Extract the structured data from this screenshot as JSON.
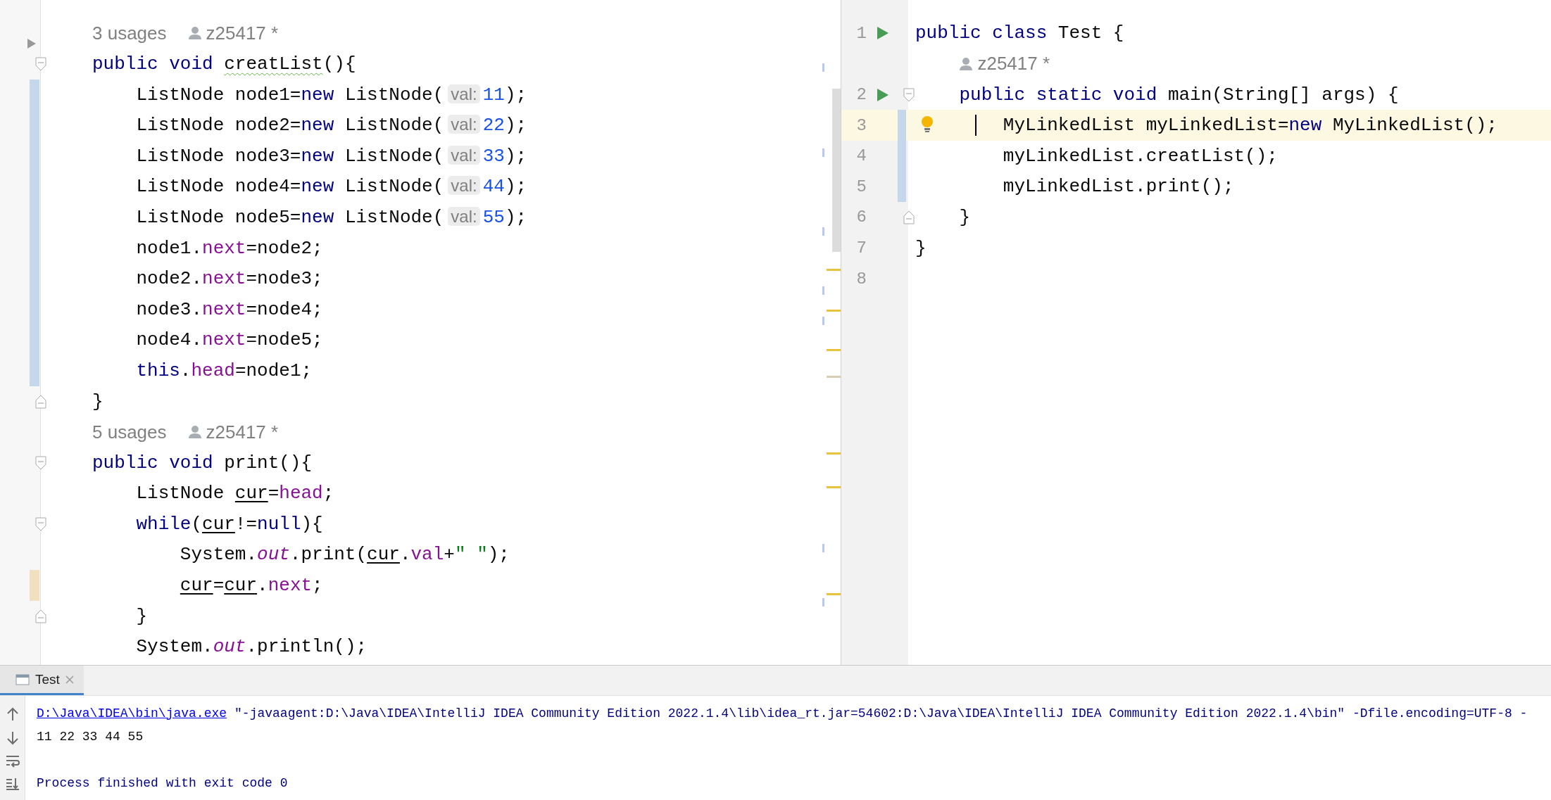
{
  "left_editor": {
    "lines": [
      {
        "kind": "vision",
        "usages": "3 usages",
        "author": "z25417 *",
        "fold": {
          "kind": "arrow"
        }
      },
      {
        "kind": "code",
        "fold": {
          "kind": "start"
        },
        "tokens": [
          {
            "kind": "keyword",
            "text": "public void "
          },
          {
            "kind": "warning",
            "text": "creatList"
          },
          {
            "kind": "plain",
            "text": "(){"
          }
        ]
      },
      {
        "kind": "code",
        "color": "#c5d7ea",
        "tokens": [
          {
            "kind": "plain",
            "text": "    ListNode node1="
          },
          {
            "kind": "keyword",
            "text": "new"
          },
          {
            "kind": "plain",
            "text": " ListNode("
          },
          {
            "kind": "hint",
            "text": "val:"
          },
          {
            "kind": "number",
            "text": "11"
          },
          {
            "kind": "plain",
            "text": ");"
          }
        ]
      },
      {
        "kind": "code",
        "color": "#c5d7ea",
        "tokens": [
          {
            "kind": "plain",
            "text": "    ListNode node2="
          },
          {
            "kind": "keyword",
            "text": "new"
          },
          {
            "kind": "plain",
            "text": " ListNode("
          },
          {
            "kind": "hint",
            "text": "val:"
          },
          {
            "kind": "number",
            "text": "22"
          },
          {
            "kind": "plain",
            "text": ");"
          }
        ]
      },
      {
        "kind": "code",
        "color": "#c5d7ea",
        "tokens": [
          {
            "kind": "plain",
            "text": "    ListNode node3="
          },
          {
            "kind": "keyword",
            "text": "new"
          },
          {
            "kind": "plain",
            "text": " ListNode("
          },
          {
            "kind": "hint",
            "text": "val:"
          },
          {
            "kind": "number",
            "text": "33"
          },
          {
            "kind": "plain",
            "text": ");"
          }
        ]
      },
      {
        "kind": "code",
        "color": "#c5d7ea",
        "tokens": [
          {
            "kind": "plain",
            "text": "    ListNode node4="
          },
          {
            "kind": "keyword",
            "text": "new"
          },
          {
            "kind": "plain",
            "text": " ListNode("
          },
          {
            "kind": "hint",
            "text": "val:"
          },
          {
            "kind": "number",
            "text": "44"
          },
          {
            "kind": "plain",
            "text": ");"
          }
        ]
      },
      {
        "kind": "code",
        "color": "#c5d7ea",
        "tokens": [
          {
            "kind": "plain",
            "text": "    ListNode node5="
          },
          {
            "kind": "keyword",
            "text": "new"
          },
          {
            "kind": "plain",
            "text": " ListNode("
          },
          {
            "kind": "hint",
            "text": "val:"
          },
          {
            "kind": "number",
            "text": "55"
          },
          {
            "kind": "plain",
            "text": ");"
          }
        ]
      },
      {
        "kind": "code",
        "color": "#c5d7ea",
        "tokens": [
          {
            "kind": "plain",
            "text": "    node1."
          },
          {
            "kind": "field",
            "text": "next"
          },
          {
            "kind": "plain",
            "text": "=node2;"
          }
        ]
      },
      {
        "kind": "code",
        "color": "#c5d7ea",
        "tokens": [
          {
            "kind": "plain",
            "text": "    node2."
          },
          {
            "kind": "field",
            "text": "next"
          },
          {
            "kind": "plain",
            "text": "=node3;"
          }
        ]
      },
      {
        "kind": "code",
        "color": "#c5d7ea",
        "tokens": [
          {
            "kind": "plain",
            "text": "    node3."
          },
          {
            "kind": "field",
            "text": "next"
          },
          {
            "kind": "plain",
            "text": "=node4;"
          }
        ]
      },
      {
        "kind": "code",
        "color": "#c5d7ea",
        "tokens": [
          {
            "kind": "plain",
            "text": "    node4."
          },
          {
            "kind": "field",
            "text": "next"
          },
          {
            "kind": "plain",
            "text": "=node5;"
          }
        ]
      },
      {
        "kind": "code",
        "color": "#c5d7ea",
        "tokens": [
          {
            "kind": "keyword",
            "text": "    this"
          },
          {
            "kind": "plain",
            "text": "."
          },
          {
            "kind": "field",
            "text": "head"
          },
          {
            "kind": "plain",
            "text": "=node1;"
          }
        ]
      },
      {
        "kind": "code",
        "fold": {
          "kind": "end"
        },
        "tokens": [
          {
            "kind": "plain",
            "text": "}"
          }
        ]
      },
      {
        "kind": "vision",
        "usages": "5 usages",
        "author": "z25417 *"
      },
      {
        "kind": "code",
        "fold": {
          "kind": "start"
        },
        "tokens": [
          {
            "kind": "keyword",
            "text": "public void "
          },
          {
            "kind": "plain",
            "text": "print(){"
          }
        ]
      },
      {
        "kind": "code",
        "tokens": [
          {
            "kind": "plain",
            "text": "    ListNode "
          },
          {
            "kind": "variable",
            "text": "cur"
          },
          {
            "kind": "plain",
            "text": "="
          },
          {
            "kind": "field",
            "text": "head"
          },
          {
            "kind": "plain",
            "text": ";"
          }
        ]
      },
      {
        "kind": "code",
        "fold": {
          "kind": "start"
        },
        "tokens": [
          {
            "kind": "keyword",
            "text": "    while"
          },
          {
            "kind": "plain",
            "text": "("
          },
          {
            "kind": "variable",
            "text": "cur"
          },
          {
            "kind": "plain",
            "text": "!="
          },
          {
            "kind": "keyword",
            "text": "null"
          },
          {
            "kind": "plain",
            "text": "){"
          }
        ]
      },
      {
        "kind": "code",
        "tokens": [
          {
            "kind": "plain",
            "text": "        System."
          },
          {
            "kind": "static",
            "text": "out"
          },
          {
            "kind": "plain",
            "text": ".print("
          },
          {
            "kind": "variable",
            "text": "cur"
          },
          {
            "kind": "plain",
            "text": "."
          },
          {
            "kind": "field",
            "text": "val"
          },
          {
            "kind": "plain",
            "text": "+"
          },
          {
            "kind": "string",
            "text": "\" \""
          },
          {
            "kind": "plain",
            "text": ");"
          }
        ]
      },
      {
        "kind": "code",
        "color": "#f0e0c0",
        "tokens": [
          {
            "kind": "variable",
            "text": "        cur"
          },
          {
            "kind": "plain",
            "text": "="
          },
          {
            "kind": "variable",
            "text": "cur"
          },
          {
            "kind": "plain",
            "text": "."
          },
          {
            "kind": "field",
            "text": "next"
          },
          {
            "kind": "plain",
            "text": ";"
          }
        ]
      },
      {
        "kind": "code",
        "fold": {
          "kind": "end"
        },
        "tokens": [
          {
            "kind": "plain",
            "text": "    }"
          }
        ]
      },
      {
        "kind": "code",
        "tokens": [
          {
            "kind": "plain",
            "text": "    System."
          },
          {
            "kind": "static",
            "text": "out"
          },
          {
            "kind": "plain",
            "text": ".println();"
          }
        ]
      }
    ]
  },
  "right_editor": {
    "lines": [
      {
        "kind": "code",
        "number": "1",
        "runnable": true,
        "current": false,
        "tokens": [
          {
            "kind": "keyword",
            "text": "public class "
          },
          {
            "kind": "plain",
            "text": "Test {"
          }
        ]
      },
      {
        "kind": "vision",
        "author": "z25417 *"
      },
      {
        "kind": "code",
        "number": "2",
        "runnable": true,
        "current": false,
        "fold": {
          "kind": "start"
        },
        "tokens": [
          {
            "kind": "keyword",
            "text": "    public static void "
          },
          {
            "kind": "plain",
            "text": "main(String[] args) {"
          }
        ]
      },
      {
        "kind": "code",
        "number": "3",
        "runnable": false,
        "current": true,
        "color": "#c5d7ea",
        "tokens": [
          {
            "kind": "plain",
            "text": "        MyLinkedList myLinkedList="
          },
          {
            "kind": "keyword",
            "text": "new"
          },
          {
            "kind": "plain",
            "text": " MyLinkedList();"
          }
        ]
      },
      {
        "kind": "code",
        "number": "4",
        "runnable": false,
        "current": false,
        "color": "#c5d7ea",
        "tokens": [
          {
            "kind": "plain",
            "text": "        myLinkedList.creatList();"
          }
        ]
      },
      {
        "kind": "code",
        "number": "5",
        "runnable": false,
        "current": false,
        "color": "#c5d7ea",
        "tokens": [
          {
            "kind": "plain",
            "text": "        myLinkedList.print();"
          }
        ]
      },
      {
        "kind": "code",
        "number": "6",
        "runnable": false,
        "current": false,
        "fold": {
          "kind": "end"
        },
        "tokens": [
          {
            "kind": "plain",
            "text": "    }"
          }
        ]
      },
      {
        "kind": "code",
        "number": "7",
        "runnable": false,
        "current": false,
        "tokens": [
          {
            "kind": "plain",
            "text": "}"
          }
        ]
      },
      {
        "kind": "code",
        "number": "8",
        "runnable": false,
        "current": false
      }
    ]
  },
  "run_panel": {
    "tabs": [
      {
        "label": "Test",
        "selected": true
      }
    ],
    "console": [
      {
        "kind": "command",
        "link": "D:\\Java\\IDEA\\bin\\java.exe",
        "text": "\"-javaagent:D:\\Java\\IDEA\\IntelliJ IDEA Community Edition 2022.1.4\\lib\\idea_rt.jar=54602:D:\\Java\\IDEA\\IntelliJ IDEA Community Edition 2022.1.4\\bin\" -Dfile.encoding=UTF-8 -"
      },
      {
        "kind": "output",
        "text": "11 22 33 44 55"
      },
      {
        "kind": "blank"
      },
      {
        "kind": "system",
        "text": "Process finished with exit code 0"
      }
    ]
  }
}
